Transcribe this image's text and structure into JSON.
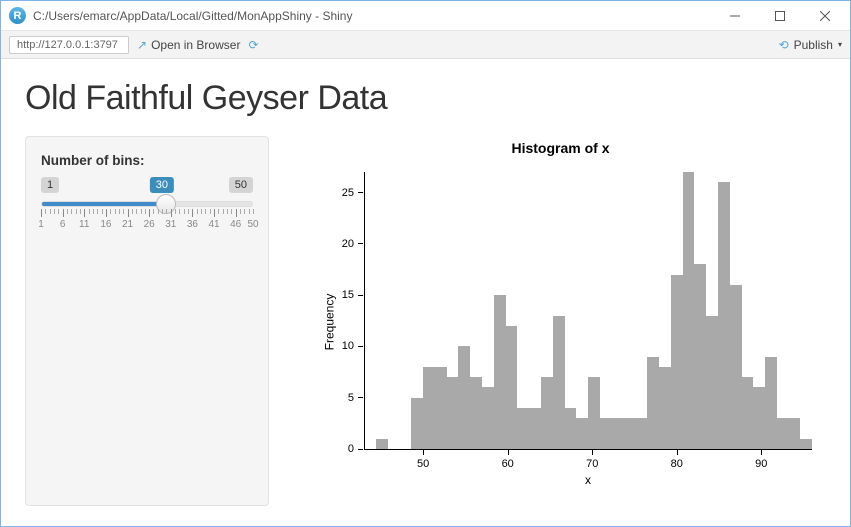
{
  "window": {
    "title": "C:/Users/emarc/AppData/Local/Gitted/MonAppShiny - Shiny"
  },
  "toolbar": {
    "url": "http://127.0.0.1:3797",
    "open_browser": "Open in Browser",
    "publish": "Publish"
  },
  "page": {
    "heading": "Old Faithful Geyser Data",
    "slider_label": "Number of bins:",
    "slider_min": "1",
    "slider_max": "50",
    "slider_value": "30",
    "slider_ticks": [
      "1",
      "6",
      "11",
      "16",
      "21",
      "26",
      "31",
      "36",
      "41",
      "46",
      "50"
    ]
  },
  "chart_data": {
    "type": "bar",
    "title": "Histogram of x",
    "xlabel": "x",
    "ylabel": "Frequency",
    "ylim": [
      0,
      27
    ],
    "yticks": [
      0,
      5,
      10,
      15,
      20,
      25
    ],
    "xticks": [
      50,
      60,
      70,
      80,
      90
    ],
    "x_range": [
      43,
      96
    ],
    "values": [
      0,
      1,
      0,
      0,
      5,
      8,
      8,
      7,
      10,
      7,
      6,
      15,
      12,
      4,
      4,
      7,
      13,
      4,
      3,
      7,
      3,
      3,
      3,
      3,
      9,
      8,
      17,
      27,
      18,
      13,
      26,
      16,
      7,
      6,
      9,
      3,
      3,
      1
    ]
  }
}
